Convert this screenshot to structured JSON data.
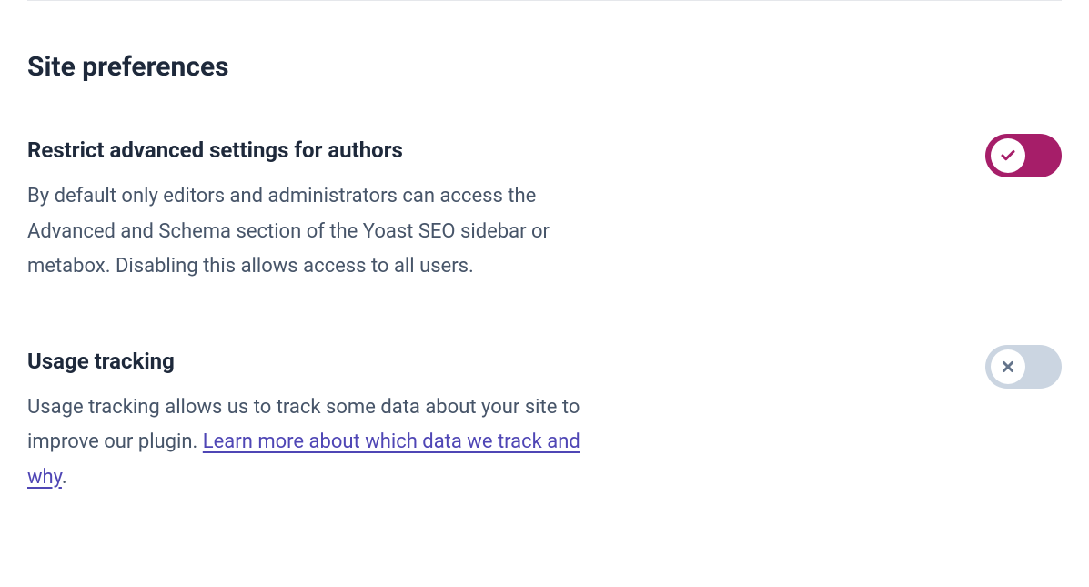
{
  "page": {
    "title": "Site preferences"
  },
  "settings": [
    {
      "title": "Restrict advanced settings for authors",
      "description": "By default only editors and administrators can access the Advanced and Schema section of the Yoast SEO sidebar or metabox. Disabling this allows access to all users.",
      "enabled": true
    },
    {
      "title": "Usage tracking",
      "description_prefix": "Usage tracking allows us to track some data about your site to improve our plugin. ",
      "link_text": "Learn more about which data we track and why",
      "description_suffix": ".",
      "enabled": false
    }
  ]
}
